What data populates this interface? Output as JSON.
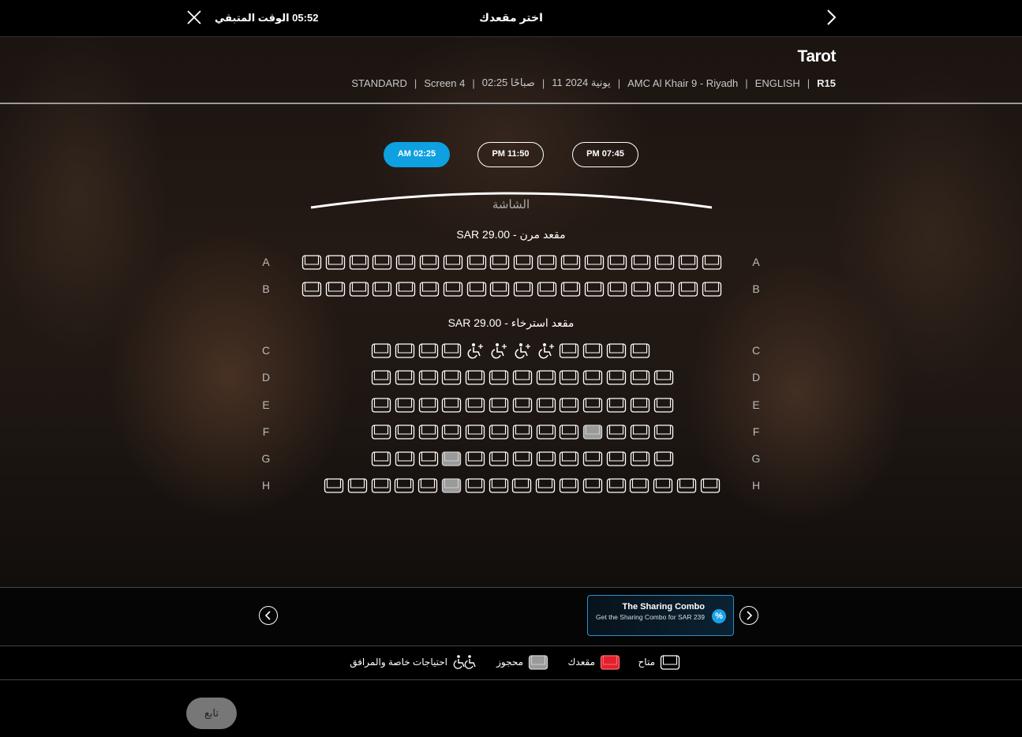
{
  "header": {
    "title": "اختر مقعدك",
    "timer_text": "05:52 الوقت المتبقي"
  },
  "movie": {
    "title": "Tarot",
    "meta": [
      "R15",
      "ENGLISH",
      "AMC Al Khair 9 - Riyadh",
      "11 يونية 2024",
      "02:25 صباحًا",
      "Screen 4",
      "STANDARD"
    ]
  },
  "showtimes": [
    {
      "label": "AM 02:25",
      "active": true
    },
    {
      "label": "PM 11:50",
      "active": false
    },
    {
      "label": "PM 07:45",
      "active": false
    }
  ],
  "screen_label": "الشاشة",
  "sections": {
    "flexible": {
      "name": "مقعد مرن",
      "price": "SAR  29.00"
    },
    "recliner": {
      "name": "مقعد استرخاء",
      "price": "SAR  29.00"
    }
  },
  "seat_map": {
    "A": [
      "a",
      "a",
      "a",
      "a",
      "a",
      "a",
      "a",
      "a",
      "a",
      "a",
      "a",
      "a",
      "a",
      "a",
      "a",
      "a",
      "a",
      "a"
    ],
    "B": [
      "a",
      "a",
      "a",
      "a",
      "a",
      "a",
      "a",
      "a",
      "a",
      "a",
      "a",
      "a",
      "a",
      "a",
      "a",
      "a",
      "a",
      "a"
    ],
    "C": [
      "a",
      "a",
      "a",
      "a",
      "w",
      "w",
      "w",
      "w",
      "a",
      "a",
      "a",
      "a"
    ],
    "D": [
      "a",
      "a",
      "a",
      "a",
      "a",
      "a",
      "a",
      "a",
      "a",
      "a",
      "a",
      "a",
      "a"
    ],
    "E": [
      "a",
      "a",
      "a",
      "a",
      "a",
      "a",
      "a",
      "a",
      "a",
      "a",
      "a",
      "a",
      "a"
    ],
    "F": [
      "a",
      "a",
      "a",
      "a",
      "a",
      "a",
      "a",
      "a",
      "a",
      "r",
      "a",
      "a",
      "a"
    ],
    "G": [
      "a",
      "a",
      "a",
      "r",
      "a",
      "a",
      "a",
      "a",
      "a",
      "a",
      "a",
      "a",
      "a"
    ],
    "H": [
      "a",
      "a",
      "a",
      "a",
      "a",
      "r",
      "a",
      "a",
      "a",
      "a",
      "a",
      "a",
      "a",
      "a",
      "a",
      "a",
      "a"
    ]
  },
  "promo": {
    "title": "The Sharing Combo",
    "description": "Get the Sharing Combo for SAR 239",
    "badge": "%"
  },
  "legend": {
    "available": "متاح",
    "selected": "مقعدك",
    "reserved": "محجوز",
    "accessible": "احتياجات خاصة والمرافق"
  },
  "colors": {
    "accent": "#0ea0e0",
    "selected_seat": "#e3202f",
    "reserved_seat": "#9a9a9a"
  },
  "continue_label": "تابع"
}
